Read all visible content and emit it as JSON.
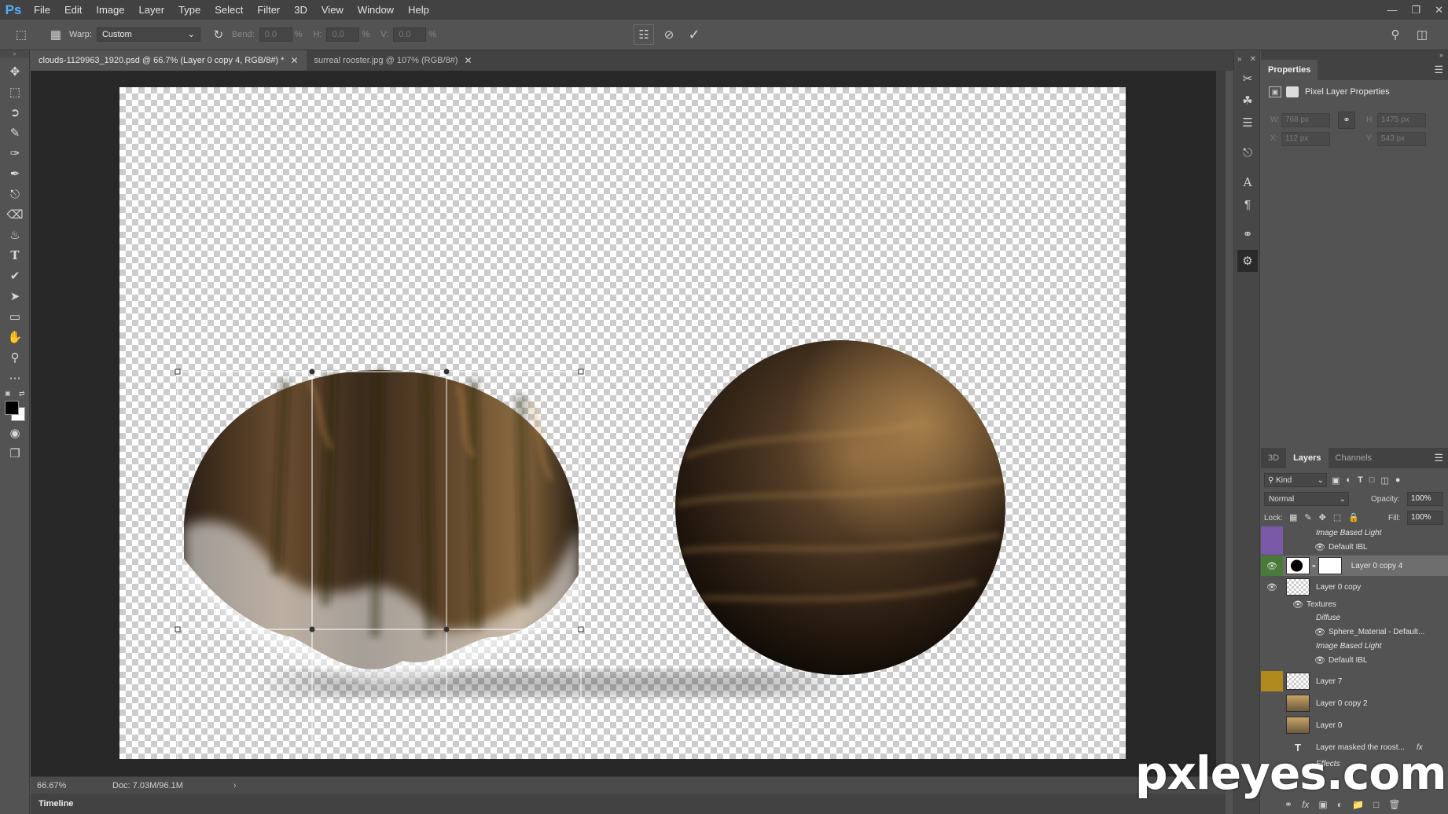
{
  "app": {
    "logo_text": "Ps",
    "menu": [
      "File",
      "Edit",
      "Image",
      "Layer",
      "Type",
      "Select",
      "Filter",
      "3D",
      "View",
      "Window",
      "Help"
    ]
  },
  "options_bar": {
    "warp_label": "Warp:",
    "warp_value": "Custom",
    "bend_label": "Bend:",
    "bend_value": "0.0",
    "h_label": "H:",
    "h_value": "0.0",
    "v_label": "V:",
    "v_value": "0.0",
    "percent": "%"
  },
  "tabs": [
    {
      "label": "clouds-1129963_1920.psd @ 66.7% (Layer 0 copy 4, RGB/8#) *",
      "active": true
    },
    {
      "label": "surreal rooster.jpg @ 107% (RGB/8#)",
      "active": false
    }
  ],
  "status": {
    "zoom": "66.67%",
    "doc": "Doc: 7.03M/96.1M"
  },
  "timeline": {
    "label": "Timeline"
  },
  "properties": {
    "tab_label": "Properties",
    "title": "Pixel Layer Properties",
    "w_label": "W:",
    "w_value": "768 px",
    "h_label": "H:",
    "h_value": "1475 px",
    "x_label": "X:",
    "x_value": "112 px",
    "y_label": "Y:",
    "y_value": "543 px"
  },
  "layers_panel": {
    "tabs": [
      "3D",
      "Layers",
      "Channels"
    ],
    "kind_label": "Kind",
    "blend_mode": "Normal",
    "opacity_label": "Opacity:",
    "opacity_value": "100%",
    "lock_label": "Lock:",
    "fill_label": "Fill:",
    "fill_value": "100%",
    "rows": [
      {
        "name": "Image Based Light",
        "type": "sub-italic"
      },
      {
        "name": "Default IBL",
        "type": "sub-eye"
      },
      {
        "name": "Layer 0 copy 4",
        "type": "layer-selected"
      },
      {
        "name": "Layer 0 copy",
        "type": "layer"
      },
      {
        "name": "Textures",
        "type": "sub-eye-top"
      },
      {
        "name": "Diffuse",
        "type": "sub-italic"
      },
      {
        "name": "Sphere_Material - Default...",
        "type": "sub-eye"
      },
      {
        "name": "Image Based Light",
        "type": "sub-italic"
      },
      {
        "name": "Default IBL",
        "type": "sub-eye"
      },
      {
        "name": "Layer 7",
        "type": "layer"
      },
      {
        "name": "Layer 0 copy 2",
        "type": "layer-photo"
      },
      {
        "name": "Layer 0",
        "type": "layer-photo"
      },
      {
        "name": "Layer masked the roost...",
        "type": "layer-text"
      },
      {
        "name": "Effects",
        "type": "sub-italic"
      }
    ],
    "fx_label": "fx"
  },
  "watermark": "pxleyes.com",
  "colors": {
    "ps_blue": "#4fb0ff",
    "selected_layer": "#6e6e6e",
    "purple_swatch": "#7a5aa6",
    "yellow_swatch": "#b08a1e"
  },
  "icons": [
    "move-icon",
    "marquee-icon",
    "lasso-icon",
    "quick-select-icon",
    "eyedropper-icon",
    "brush-icon",
    "stamp-icon",
    "eraser-icon",
    "bucket-icon",
    "type-icon",
    "pen-icon",
    "path-select-icon",
    "rectangle-icon",
    "hand-icon",
    "zoom-icon",
    "more-icon"
  ]
}
